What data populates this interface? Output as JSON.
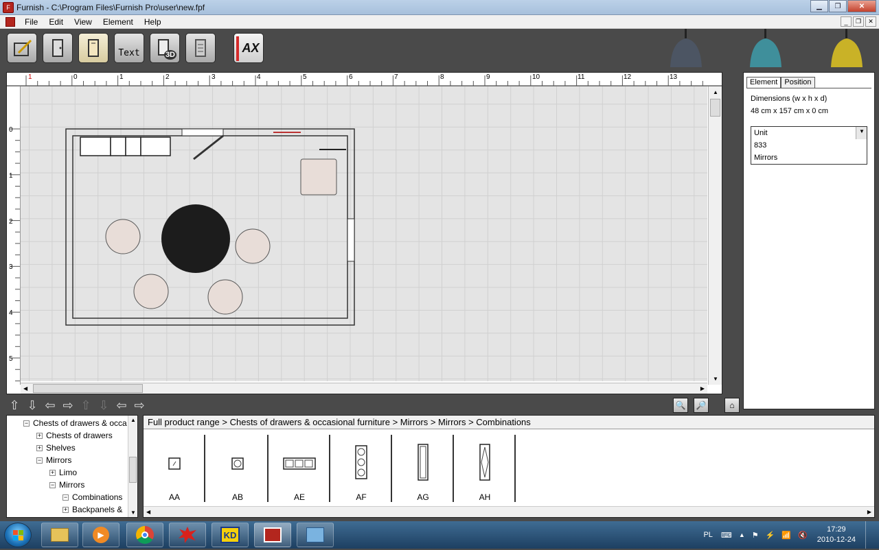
{
  "window": {
    "title": "Furnish - C:\\Program Files\\Furnish Pro\\user\\new.fpf"
  },
  "menu": {
    "items": [
      "File",
      "Edit",
      "View",
      "Element",
      "Help"
    ]
  },
  "toolbar": {
    "text_tool_label": "Text",
    "threed_label": "3D",
    "ax_label": "AX"
  },
  "ruler": {
    "top": [
      "1",
      "0",
      "1",
      "2",
      "3",
      "4",
      "5",
      "6",
      "7",
      "8",
      "9",
      "10",
      "11",
      "12",
      "13"
    ],
    "left": [
      "0",
      "1",
      "2",
      "3",
      "4",
      "5"
    ]
  },
  "properties": {
    "tabs": [
      "Element",
      "Position"
    ],
    "dimensions_label": "Dimensions (w x h x d)",
    "dimensions_value": "48 cm x 157 cm x 0 cm",
    "list": [
      "Unit",
      "833",
      "Mirrors"
    ]
  },
  "tree": {
    "items": [
      {
        "label": "Chests of drawers & occa",
        "expander": "−"
      },
      {
        "label": "Chests of drawers",
        "expander": "+"
      },
      {
        "label": "Shelves",
        "expander": "+"
      },
      {
        "label": "Mirrors",
        "expander": "−"
      },
      {
        "label": "Limo",
        "expander": "+"
      },
      {
        "label": "Mirrors",
        "expander": "−"
      },
      {
        "label": "Combinations",
        "expander": "−"
      },
      {
        "label": "Backpanels &",
        "expander": "+"
      }
    ]
  },
  "catalog": {
    "breadcrumb": "Full product range > Chests of drawers & occasional furniture > Mirrors > Mirrors > Combinations",
    "products": [
      "AA",
      "AB",
      "AE",
      "AF",
      "AG",
      "AH"
    ]
  },
  "taskbar": {
    "language": "PL",
    "time": "17:29",
    "date": "2010-12-24"
  },
  "colors": {
    "toolbar_bg": "#4a4a4a",
    "grid_bg": "#e4e4e4",
    "ax_red": "#d42a2a",
    "table_fill": "#1c1c1c",
    "chair_fill": "#e8ddd8",
    "lamp_dark": "#4c5563",
    "lamp_teal": "#3f8f9b",
    "lamp_yellow": "#c9b227"
  }
}
